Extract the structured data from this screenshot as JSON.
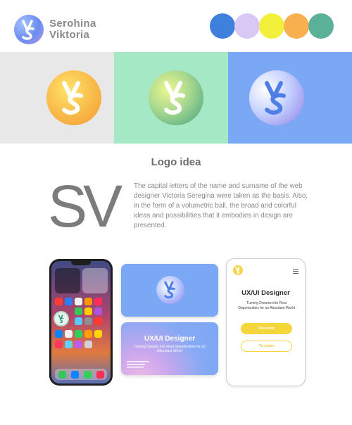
{
  "brand": {
    "line1": "Serohina",
    "line2": "Viktoria"
  },
  "palette": [
    "#3f80dc",
    "#d8c8f6",
    "#f3f03c",
    "#f8b04f",
    "#5ab197"
  ],
  "panels": [
    {
      "bg": "#e8e8e8",
      "ball": "radial-gradient(circle at 40% 35%, #ffe46a, #f8b948 55%, #f49b33 100%)",
      "mono": "#ffffff"
    },
    {
      "bg": "#a4e8c6",
      "ball": "radial-gradient(circle at 35% 35%, #ecf68f, #a7d88f 45%, #3fa083 100%)",
      "mono": "#ffffff"
    },
    {
      "bg": "#7ba8f5",
      "ball": "radial-gradient(circle at 30% 35%, #ffffff, #c6d2ff 45%, #8e7de6 100%)",
      "mono": "#4f7fe6"
    }
  ],
  "section": {
    "title": "Logo idea",
    "big_letters": "SV",
    "description": "The capital letters of the name and surname of the web designer Victoria Seregina were taken as the basis. Also, in the form of a volumetric ball, the broad and colorful ideas and possibilities that it embodies in design are presented."
  },
  "business_card": {
    "title": "UX/UI Designer",
    "subtitle": "Turning Dreams into Real Opportunities for an Abundant World"
  },
  "mobile_site": {
    "title": "UX/UI Designer",
    "subtitle": "Turning Dreams into Real Opportunities for an Abundant World",
    "discover_label": "Discover",
    "order_label": "To order"
  }
}
